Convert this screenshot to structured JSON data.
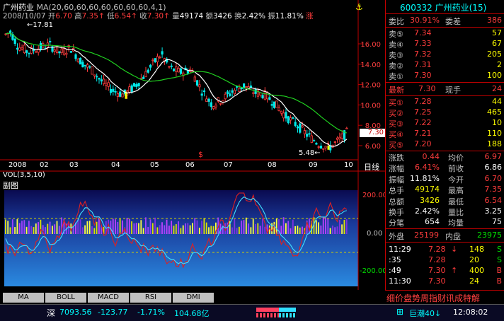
{
  "stock": {
    "name": "广州药业",
    "code": "600332",
    "code_name": "600332 广州药业(15)"
  },
  "info_line": {
    "ma_label": "MA(20,60,60,60,60,60,60,60,4,1)",
    "date": "2008/10/07",
    "open_label": "开",
    "open": "6.70",
    "high_label": "高",
    "high": "7.35",
    "low_label": "低",
    "low": "6.54",
    "close_label": "收",
    "close": "7.30",
    "vol_label": "量",
    "vol": "49174",
    "amt_label": "额",
    "amt": "3426",
    "turn_label": "换",
    "turn": "2.42%",
    "amp_label": "振",
    "amp": "11.81%",
    "rise_label": "涨"
  },
  "price_axis": [
    "16.00",
    "14.00",
    "12.00",
    "10.00",
    "8.00",
    "6.00"
  ],
  "current_price_tag": "7.30",
  "max_label": "17.81",
  "min_label": "5.48",
  "x_axis": [
    "2008",
    "02",
    "03",
    "04",
    "05",
    "06",
    "07",
    "08",
    "09",
    "10"
  ],
  "period_label": "日线",
  "vol_label": "VOL(3,5,10)",
  "sub_label": "副图",
  "sub_axis": [
    "200.00",
    "0.00",
    "-200.00"
  ],
  "tabs": [
    "MA",
    "BOLL",
    "MACD",
    "RSI",
    "DMI"
  ],
  "quote": {
    "weibi_label": "委比",
    "weibi": "30.91%",
    "weicha_label": "委差",
    "weicha": "386",
    "sell": [
      {
        "label": "卖⑤",
        "price": "7.34",
        "vol": "57"
      },
      {
        "label": "卖④",
        "price": "7.33",
        "vol": "67"
      },
      {
        "label": "卖③",
        "price": "7.32",
        "vol": "205"
      },
      {
        "label": "卖②",
        "price": "7.31",
        "vol": "2"
      },
      {
        "label": "卖①",
        "price": "7.30",
        "vol": "100"
      }
    ],
    "latest_label": "最新",
    "latest": "7.30",
    "xianshou_label": "现手",
    "xianshou": "24",
    "buy": [
      {
        "label": "买①",
        "price": "7.28",
        "vol": "44"
      },
      {
        "label": "买②",
        "price": "7.25",
        "vol": "465"
      },
      {
        "label": "买③",
        "price": "7.22",
        "vol": "10"
      },
      {
        "label": "买④",
        "price": "7.21",
        "vol": "110"
      },
      {
        "label": "买⑤",
        "price": "7.20",
        "vol": "188"
      }
    ],
    "stats": [
      {
        "l1": "涨跌",
        "v1": "0.44",
        "l2": "均价",
        "v2": "6.97"
      },
      {
        "l1": "涨幅",
        "v1": "6.41%",
        "l2": "前收",
        "v2": "6.86"
      },
      {
        "l1": "振幅",
        "v1": "11.81%",
        "l2": "今开",
        "v2": "6.70"
      },
      {
        "l1": "总手",
        "v1": "49174",
        "l2": "最高",
        "v2": "7.35"
      },
      {
        "l1": "总额",
        "v1": "3426",
        "l2": "最低",
        "v2": "6.54"
      },
      {
        "l1": "换手",
        "v1": "2.42%",
        "l2": "量比",
        "v2": "3.25"
      },
      {
        "l1": "分笔",
        "v1": "654",
        "l2": "均量",
        "v2": "75"
      }
    ],
    "waipan_label": "外盘",
    "waipan": "25199",
    "neipan_label": "内盘",
    "neipan": "23975",
    "ticks": [
      {
        "time": "11:29",
        "price": "7.28",
        "dir": "↓",
        "vol": "148",
        "side": "S"
      },
      {
        "time": ":35",
        "price": "7.28",
        "dir": "",
        "vol": "20",
        "side": "S"
      },
      {
        "time": ":49",
        "price": "7.30",
        "dir": "↑",
        "vol": "400",
        "side": "B"
      },
      {
        "time": "11:30",
        "price": "7.30",
        "dir": "",
        "vol": "24",
        "side": "B"
      }
    ],
    "bottom_tabs": "细价盘势周指财讯成特解"
  },
  "status": {
    "index_name": "深",
    "index_value": "7093.56",
    "index_change": "-123.77",
    "index_pct": "-1.71%",
    "index_amt": "104.68亿",
    "chaoliu": "巨潮40↓",
    "time": "12:08:02"
  },
  "colors": {
    "up": "#ff3c3c",
    "down": "#00e000",
    "ma_white": "#ffffff",
    "ma_green": "#00d000"
  }
}
